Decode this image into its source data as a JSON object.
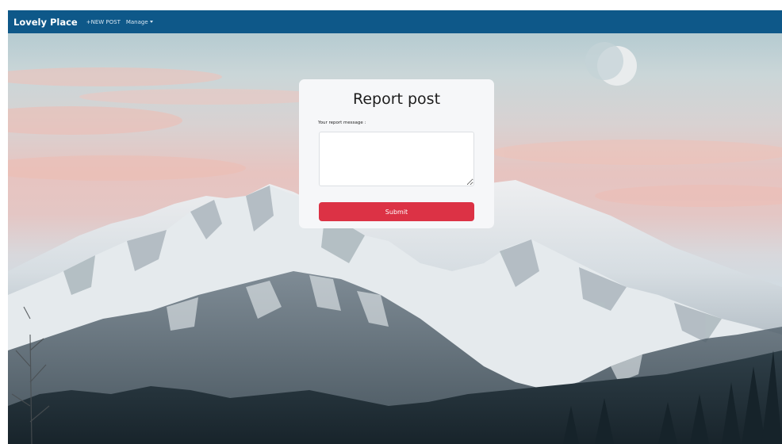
{
  "navbar": {
    "brand": "Lovely Place",
    "new_post_label": "+NEW POST",
    "manage_label": "Manage"
  },
  "report_form": {
    "title": "Report post",
    "message_label": "Your report message :",
    "message_value": "",
    "submit_label": "Submit"
  },
  "colors": {
    "navbar": "#0e5889",
    "submit": "#dc3245",
    "card": "#f6f7f9"
  },
  "icons": [
    "chevron-down-icon",
    "resize-handle-icon"
  ]
}
